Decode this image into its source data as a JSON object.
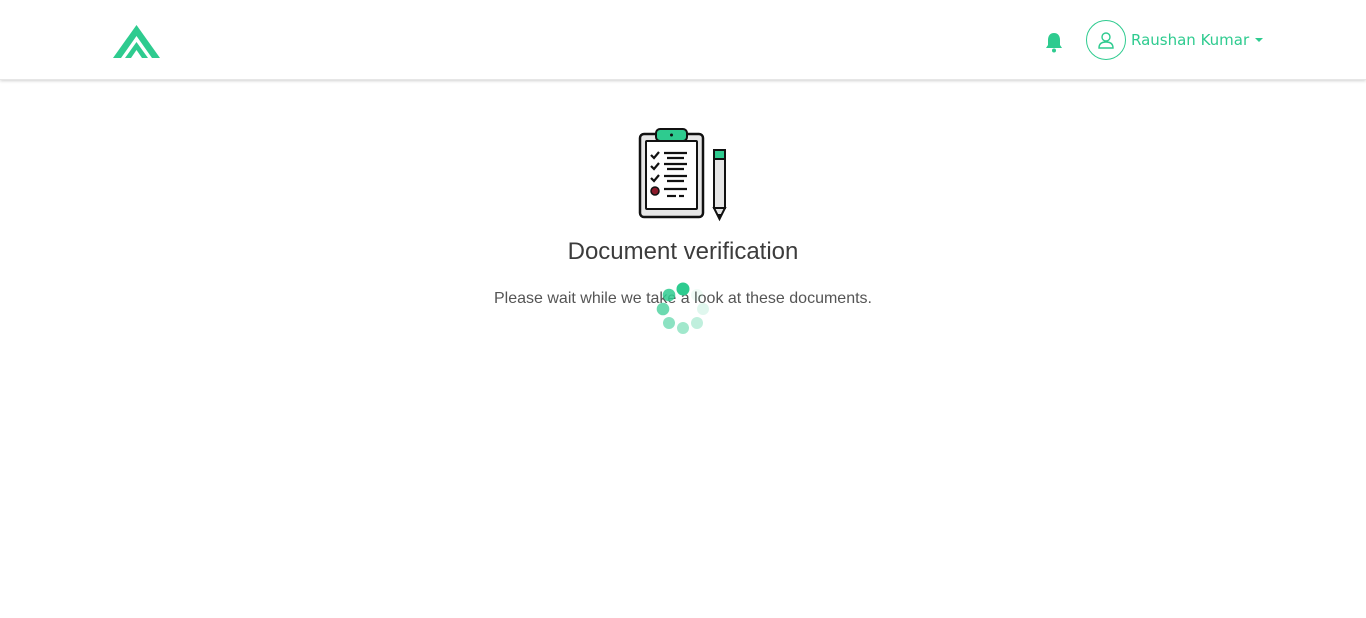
{
  "header": {
    "logo_icon": "brand-chevron-logo",
    "notification_icon": "bell-icon",
    "user": {
      "avatar_icon": "user-outline-icon",
      "name": "Raushan Kumar",
      "menu_icon": "caret-down-icon"
    }
  },
  "main": {
    "illustration_icon": "clipboard-checklist-pencil-icon",
    "title": "Document verification",
    "message": "Please wait while we take a look at these documents.",
    "loading_icon": "spinner-dots-icon"
  },
  "colors": {
    "accent": "#2ecb8f",
    "text_dark": "#3c3c3c",
    "text_muted": "#555555"
  }
}
